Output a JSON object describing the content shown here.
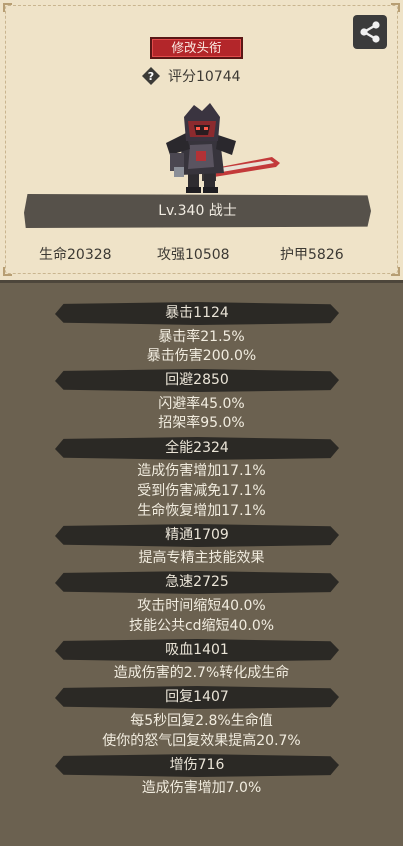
{
  "profile": {
    "title_button": "修改头衔",
    "score": "评分10744",
    "level_class": "Lv.340 战士",
    "base_stats": {
      "hp": "生命20328",
      "attack": "攻强10508",
      "armor": "护甲5826"
    }
  },
  "stats": [
    {
      "header": "暴击1124",
      "lines": [
        "暴击率21.5%",
        "暴击伤害200.0%"
      ]
    },
    {
      "header": "回避2850",
      "lines": [
        "闪避率45.0%",
        "招架率95.0%"
      ]
    },
    {
      "header": "全能2324",
      "lines": [
        "造成伤害增加17.1%",
        "受到伤害减免17.1%",
        "生命恢复增加17.1%"
      ]
    },
    {
      "header": "精通1709",
      "lines": [
        "提高专精主技能效果"
      ]
    },
    {
      "header": "急速2725",
      "lines": [
        "攻击时间缩短40.0%",
        "技能公共cd缩短40.0%"
      ]
    },
    {
      "header": "吸血1401",
      "lines": [
        "造成伤害的2.7%转化成生命"
      ]
    },
    {
      "header": "回复1407",
      "lines": [
        "每5秒回复2.8%生命值",
        "使你的怒气回复效果提高20.7%"
      ]
    },
    {
      "header": "增伤716",
      "lines": [
        "造成伤害增加7.0%"
      ]
    }
  ],
  "colors": {
    "background": "#6b6150",
    "panel": "#efe3c8",
    "title_button": "#b3262a",
    "header_bar": "#2b2925"
  },
  "icons": [
    "share-icon",
    "help-icon",
    "hero-sprite"
  ]
}
